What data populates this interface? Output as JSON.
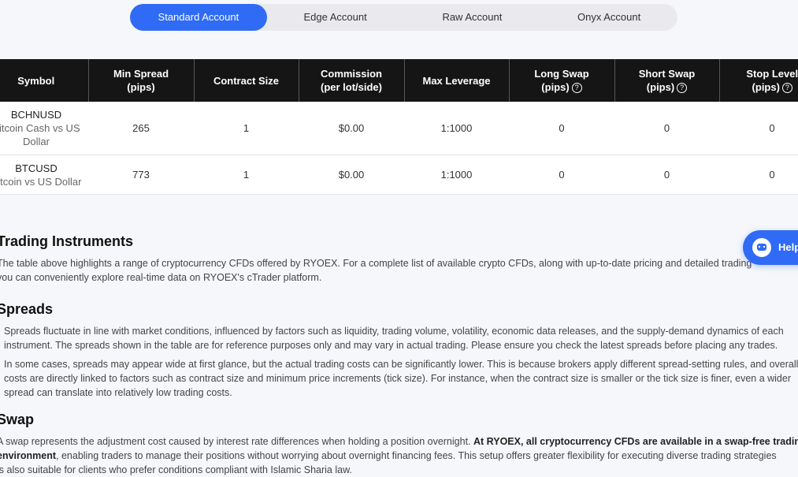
{
  "tabs": [
    "Standard Account",
    "Edge Account",
    "Raw Account",
    "Onyx Account"
  ],
  "active_tab": 0,
  "table": {
    "headers": [
      {
        "line1": "Symbol",
        "line2": ""
      },
      {
        "line1": "Min Spread",
        "line2": "(pips)"
      },
      {
        "line1": "Contract Size",
        "line2": ""
      },
      {
        "line1": "Commission",
        "line2": "(per lot/side)"
      },
      {
        "line1": "Max Leverage",
        "line2": ""
      },
      {
        "line1": "Long Swap",
        "line2": "(pips)"
      },
      {
        "line1": "Short Swap",
        "line2": "(pips)"
      },
      {
        "line1": "Stop Level",
        "line2": "(pips)"
      }
    ],
    "rows": [
      {
        "symbol": "BCHNUSD",
        "name": "Bitcoin Cash vs US Dollar",
        "min_spread": "265",
        "contract_size": "1",
        "commission": "$0.00",
        "max_leverage": "1:1000",
        "long_swap": "0",
        "short_swap": "0",
        "stop_level": "0"
      },
      {
        "symbol": "BTCUSD",
        "name": "Bitcoin vs US Dollar",
        "min_spread": "773",
        "contract_size": "1",
        "commission": "$0.00",
        "max_leverage": "1:1000",
        "long_swap": "0",
        "short_swap": "0",
        "stop_level": "0"
      }
    ]
  },
  "sections": {
    "trading": {
      "title": "Trading Instruments",
      "p1": "The table above highlights a range of cryptocurrency CFDs offered by RYOEX. For a complete list of available crypto CFDs, along with up-to-date pricing and detailed trading",
      "p2": "you can conveniently explore real-time data on RYOEX's cTrader platform."
    },
    "spreads": {
      "title": "Spreads",
      "p1": "Spreads fluctuate in line with market conditions, influenced by factors such as liquidity, trading volume, volatility, economic data releases, and the supply-demand dynamics of each",
      "p2": "instrument. The spreads shown in the table are for reference purposes only and may vary in actual trading. Please ensure you check the latest spreads before placing any trades.",
      "p3": "In some cases, spreads may appear wide at first glance, but the actual trading costs can be significantly lower. This is because brokers apply different spread-setting rules, and overall",
      "p4": "costs are directly linked to factors such as contract size and minimum price increments (tick size). For instance, when the contract size is smaller or the tick size is finer, even a wider",
      "p5": "spread can translate into relatively low trading costs."
    },
    "swap": {
      "title": "Swap",
      "p1_a": "A swap represents the adjustment cost caused by interest rate differences when holding a position overnight. ",
      "p1_b": "At RYOEX, all cryptocurrency CFDs are available in a swap-free trading",
      "p2_b": "environment",
      "p2_a": ", enabling traders to manage their positions without worrying about overnight financing fees. This setup offers greater flexibility for executing diverse trading strategies",
      "p3": "is also suitable for clients who prefer conditions compliant with Islamic Sharia law."
    }
  },
  "help": {
    "label": "Help"
  },
  "colors": {
    "accent": "#2f6bf5",
    "header_bg": "#151515",
    "page_bg": "#f6f7fb"
  }
}
